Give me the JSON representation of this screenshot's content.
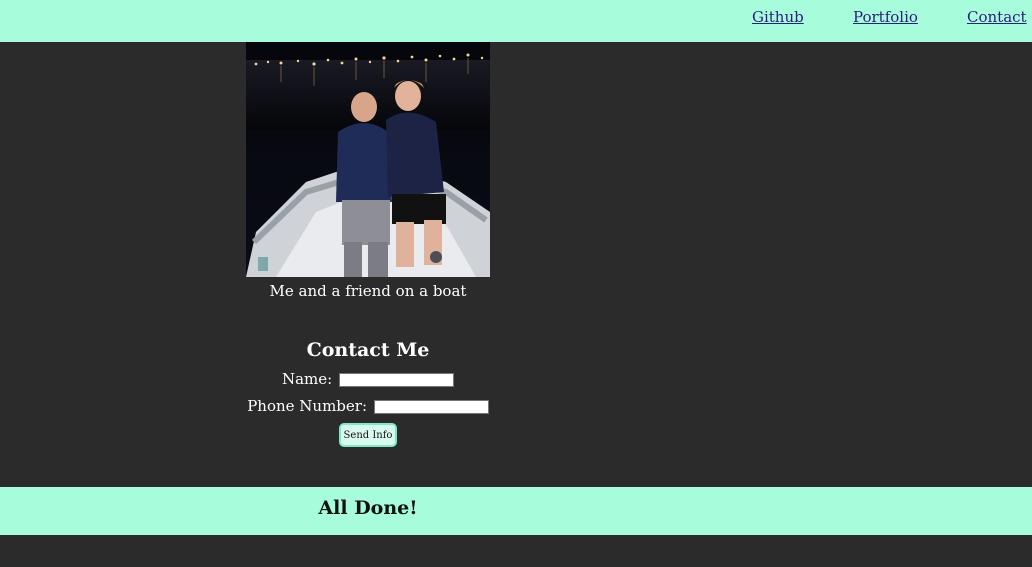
{
  "nav": {
    "github": "Github",
    "portfolio": "Portfolio",
    "contact": "Contact"
  },
  "photo": {
    "alt": "Two people sitting on the bow of a boat at night",
    "caption": "Me and a friend on a boat"
  },
  "contact_form": {
    "title": "Contact Me",
    "name_label": "Name:",
    "name_value": "",
    "phone_label": "Phone Number:",
    "phone_value": "",
    "submit_label": "Send Info"
  },
  "footer": {
    "text": "All Done!"
  },
  "colors": {
    "accent": "#a6fcdb",
    "background": "#2b2b2b",
    "link": "#2b1f7a"
  }
}
